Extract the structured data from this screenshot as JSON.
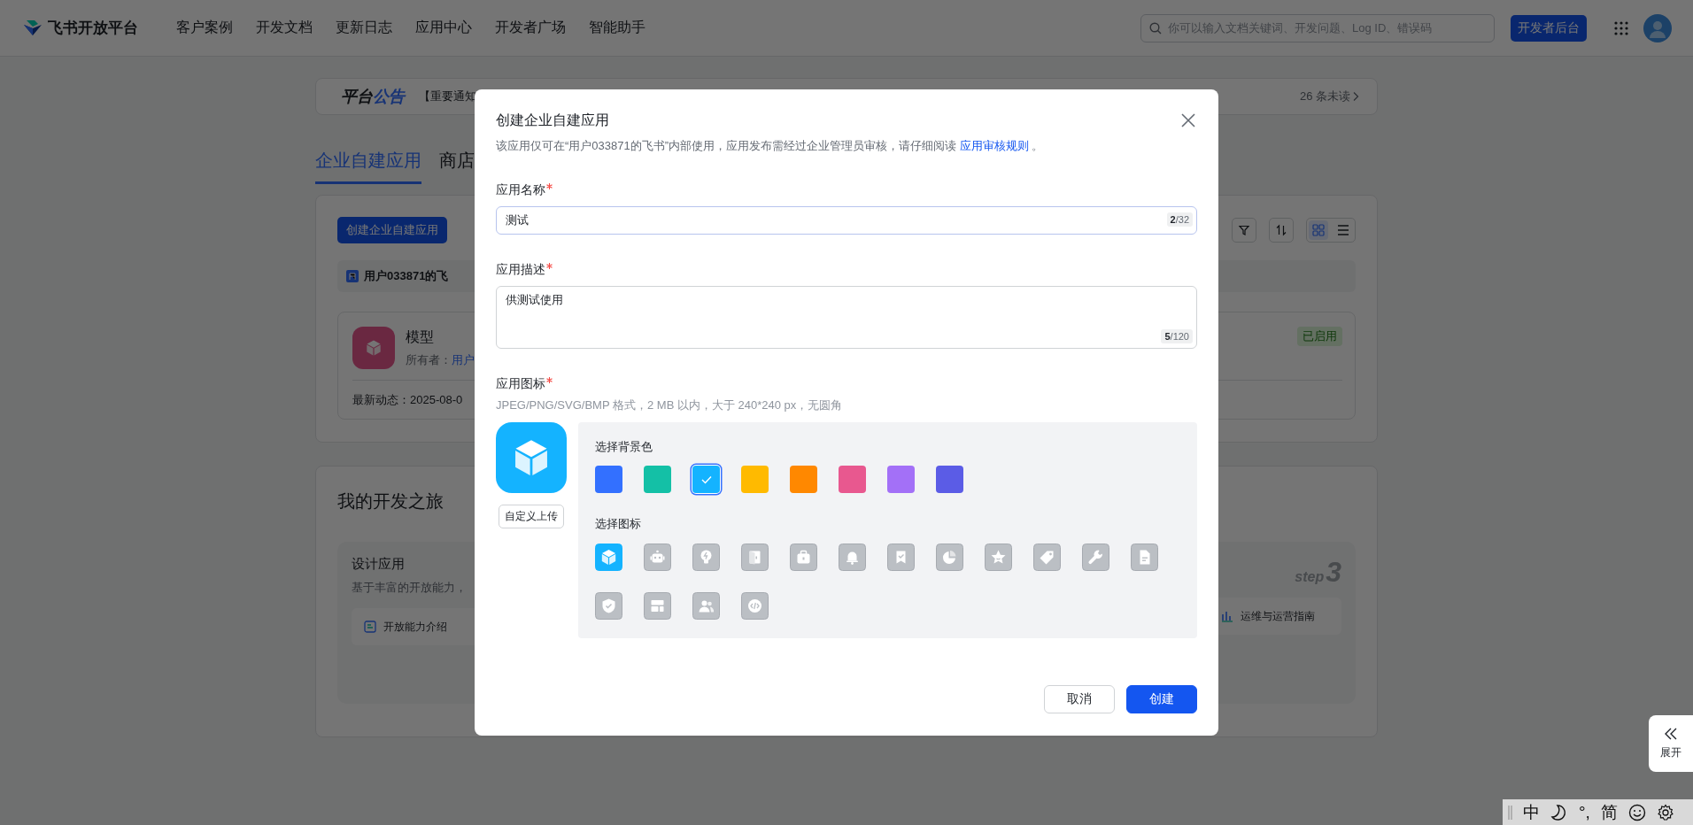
{
  "header": {
    "brand": "飞书开放平台",
    "nav": [
      {
        "label": "客户案例"
      },
      {
        "label": "开发文档"
      },
      {
        "label": "更新日志"
      },
      {
        "label": "应用中心"
      },
      {
        "label": "开发者广场"
      },
      {
        "label": "智能助手"
      }
    ],
    "search": {
      "placeholder": "你可以输入文档关键词、开发问题、Log ID、错误码"
    },
    "console_button": "开发者后台"
  },
  "notice": {
    "title_parts": [
      "平台",
      "公告"
    ],
    "text": "【重要通知",
    "unread": "26 条未读"
  },
  "tabs": [
    {
      "label": "企业自建应用",
      "selected": true
    },
    {
      "label": "商店",
      "selected": false
    }
  ],
  "apps_panel": {
    "create_button": "创建企业自建应用",
    "views": [
      {
        "kind": "grid",
        "selected": true
      },
      {
        "kind": "list",
        "selected": false
      }
    ],
    "tenant": "用户033871的飞",
    "app": {
      "name": "模型",
      "owner_label": "所有者：",
      "owner": "用户",
      "status": "已启用",
      "activity": "最新动态：2025-08-0"
    }
  },
  "journey": {
    "title": "我的开发之旅",
    "step_title": "设计应用",
    "step_desc": "基于丰富的开放能力，",
    "step_mark": "step",
    "step_number": "3",
    "links": [
      "开放能力介绍",
      "运维与运营指南"
    ]
  },
  "dialog": {
    "title": "创建企业自建应用",
    "description": {
      "before": "该应用仅可在“用户033871的飞书”内部使用，应用发布需经过企业管理员审核，请仔细阅读 ",
      "link": "应用审核规则",
      "after": " 。"
    },
    "fields": [
      {
        "kind": "input",
        "label": "应用名称",
        "required": true,
        "value": "测试",
        "counter": "**2**/32"
      },
      {
        "kind": "textarea",
        "label": "应用描述",
        "required": true,
        "value": "供测试使用",
        "counter": "**5**/120"
      }
    ],
    "icon_section": {
      "label": "应用图标",
      "required": true,
      "hint": "JPEG/PNG/SVG/BMP 格式，2 MB 以内，大于 240*240 px，无圆角",
      "upload_button": "自定义上传",
      "color_heading": "选择背景色",
      "colors": [
        {
          "color": "#3370ff",
          "selected": false
        },
        {
          "color": "#14c0a6",
          "selected": false
        },
        {
          "color": "#14b3ff",
          "selected": true
        },
        {
          "color": "#ffba00",
          "selected": false
        },
        {
          "color": "#ff8800",
          "selected": false
        },
        {
          "color": "#e8588f",
          "selected": false
        },
        {
          "color": "#a370f7",
          "selected": false
        },
        {
          "color": "#5b5ce6",
          "selected": false
        }
      ],
      "icon_heading": "选择图标",
      "icons": [
        {
          "kind": "cube",
          "selected": true
        },
        {
          "kind": "robot",
          "selected": false
        },
        {
          "kind": "bulb",
          "selected": false
        },
        {
          "kind": "door",
          "selected": false
        },
        {
          "kind": "briefcase",
          "selected": false
        },
        {
          "kind": "bell",
          "selected": false
        },
        {
          "kind": "bookmark",
          "selected": false
        },
        {
          "kind": "pie",
          "selected": false
        },
        {
          "kind": "star",
          "selected": false
        },
        {
          "kind": "tag",
          "selected": false
        },
        {
          "kind": "wrench",
          "selected": false
        },
        {
          "kind": "document",
          "selected": false
        },
        {
          "kind": "shield",
          "selected": false
        },
        {
          "kind": "layout",
          "selected": false
        },
        {
          "kind": "people",
          "selected": false
        },
        {
          "kind": "code",
          "selected": false
        }
      ]
    },
    "buttons": [
      {
        "kind": "secondary",
        "label": "取消"
      },
      {
        "kind": "primary",
        "label": "创建"
      }
    ]
  },
  "side_tab": {
    "label": "展开"
  },
  "ime_bar": {
    "items": [
      {
        "kind": "text",
        "text": "中"
      },
      {
        "kind": "moon"
      },
      {
        "kind": "text",
        "text": "°,"
      },
      {
        "kind": "text",
        "text": "简"
      },
      {
        "kind": "smiley"
      },
      {
        "kind": "gear"
      }
    ]
  }
}
